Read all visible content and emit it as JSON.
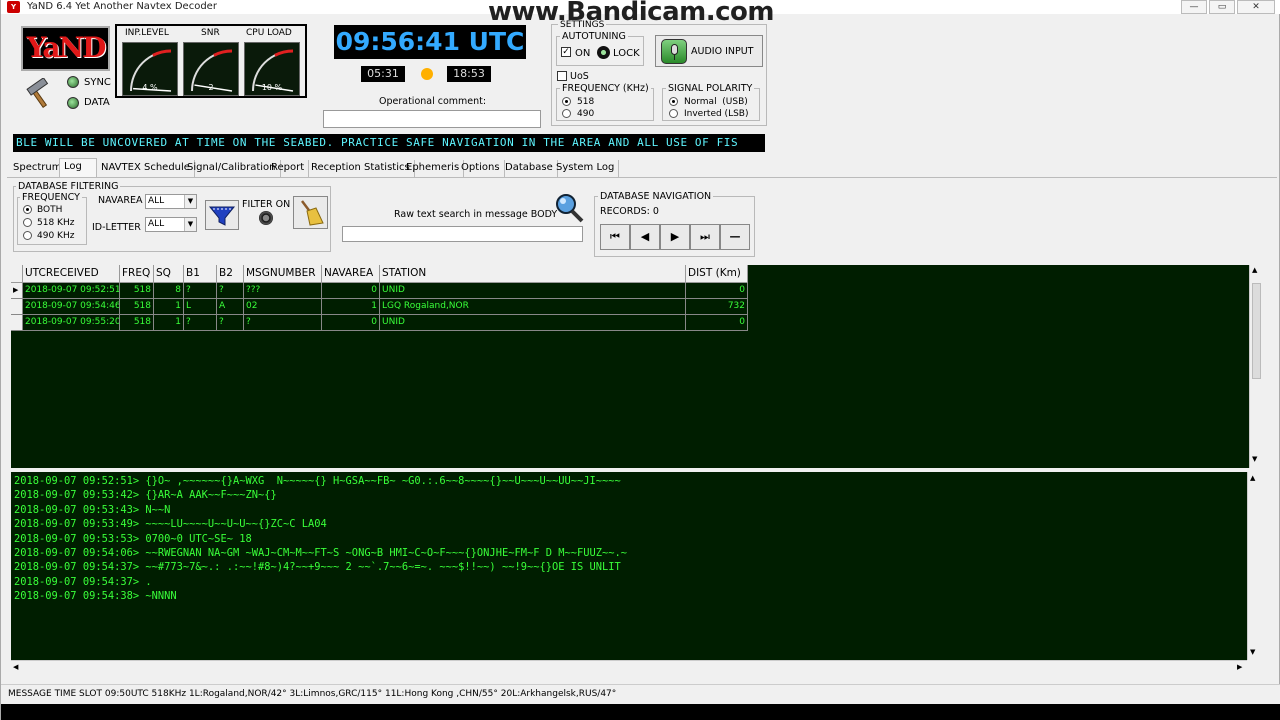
{
  "window": {
    "title": "YaND 6.4 Yet Another Navtex Decoder",
    "minimize": "—",
    "maximize": "▭",
    "close": "✕"
  },
  "watermark": "www.Bandicam.com",
  "logo": "YaND",
  "indicators": {
    "sync": "SYNC",
    "data": "DATA"
  },
  "gauges": [
    {
      "label": "INP.LEVEL",
      "value": "4 %",
      "level": 0.04
    },
    {
      "label": "SNR",
      "value": "2",
      "level": 0.1
    },
    {
      "label": "CPU LOAD",
      "value": "10 %",
      "level": 0.1
    }
  ],
  "clock": {
    "time": "09:56:41 UTC",
    "sunrise": "05:31",
    "sunset": "18:53"
  },
  "operational_comment": {
    "label": "Operational comment:",
    "value": ""
  },
  "settings": {
    "title": "SETTINGS",
    "autotuning": {
      "title": "AUTOTUNING",
      "on_label": "ON",
      "on_checked": true,
      "lock_label": "LOCK"
    },
    "audio_input": "AUDIO INPUT",
    "uos": {
      "label": "UoS",
      "checked": false
    },
    "frequency": {
      "title": "FREQUENCY (KHz)",
      "options": [
        "518",
        "490"
      ],
      "selected": "518"
    },
    "polarity": {
      "title": "SIGNAL POLARITY",
      "options": [
        "Normal  (USB)",
        "Inverted (LSB)"
      ],
      "selected": "Normal  (USB)"
    }
  },
  "ticker": "BLE WILL BE UNCOVERED AT TIME ON THE SEABED. PRACTICE SAFE NAVIGATION IN THE AREA AND ALL USE OF FIS",
  "tabs": [
    "Spectrum",
    "Log",
    "NAVTEX Schedule",
    "Signal/Calibration",
    "Report",
    "Reception Statistics",
    "Ephemeris",
    "Options",
    "Database",
    "System Log"
  ],
  "active_tab": "Log",
  "filtering": {
    "title": "DATABASE FILTERING",
    "frequency": {
      "title": "FREQUENCY",
      "options": [
        "BOTH",
        "518 KHz",
        "490 KHz"
      ],
      "selected": "BOTH"
    },
    "navarea": {
      "label": "NAVAREA",
      "value": "ALL"
    },
    "id_letter": {
      "label": "ID-LETTER",
      "value": "ALL"
    },
    "filter_on": "FILTER ON",
    "search": {
      "label": "Raw text search in message BODY",
      "value": ""
    }
  },
  "navigation": {
    "title": "DATABASE NAVIGATION",
    "records": "RECORDS: 0",
    "buttons": [
      "⏮",
      "◀",
      "▶",
      "⏭",
      "—"
    ]
  },
  "table": {
    "columns": [
      "UTCRECEIVED",
      "FREQ",
      "SQ",
      "B1",
      "B2",
      "MSGNUMBER",
      "NAVAREA",
      "STATION",
      "DIST (Km)"
    ],
    "rows": [
      [
        "2018-09-07 09:52:51",
        "518",
        "8",
        "?",
        "?",
        "???",
        "0",
        "UNID",
        "0"
      ],
      [
        "2018-09-07 09:54:46",
        "518",
        "1",
        "L",
        "A",
        "02",
        "1",
        "LGQ Rogaland,NOR",
        "732"
      ],
      [
        "2018-09-07 09:55:20",
        "518",
        "1",
        "?",
        "?",
        "?",
        "0",
        "UNID",
        "0"
      ]
    ]
  },
  "log_lines": [
    "2018-09-07 09:52:51> {}O~ ,~~~~~~{}A~WXG  N~~~~~{} H~GSA~~FB~ ~G0.:.6~~8~~~~{}~~U~~~U~~UU~~JI~~~~",
    "2018-09-07 09:53:42> {}AR~A AAK~~F~~~ZN~{}",
    "2018-09-07 09:53:43> N~~N",
    "2018-09-07 09:53:49> ~~~~LU~~~~U~~U~U~~{}ZC~C LA04",
    "2018-09-07 09:53:53> 0700~0 UTC~SE~ 18",
    "2018-09-07 09:54:06> ~~RWEGNAN NA~GM ~WAJ~CM~M~~FT~S ~ONG~B HMI~C~O~F~~~{}ONJHE~FM~F D M~~FUUZ~~.~",
    "2018-09-07 09:54:37> ~~#773~7&~.: .:~~!#8~)4?~~+9~~~ 2 ~~`.7~~6~=~. ~~~$!!~~) ~~!9~~{}OE IS UNLIT",
    "2018-09-07 09:54:37> .",
    "2018-09-07 09:54:38> ~NNNN"
  ],
  "status": "MESSAGE TIME SLOT 09:50UTC 518KHz 1L:Rogaland,NOR/42° 3L:Limnos,GRC/115° 11L:Hong Kong  ,CHN/55° 20L:Arkhangelsk,RUS/47°"
}
